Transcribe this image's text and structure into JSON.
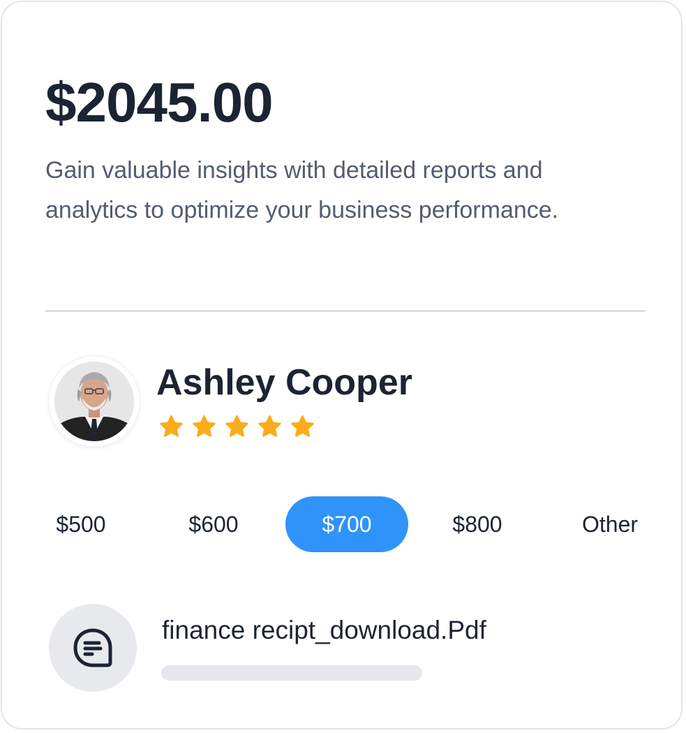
{
  "card": {
    "price": "$2045.00",
    "description": "Gain valuable insights with detailed reports and analytics to optimize your business performance."
  },
  "profile": {
    "name": "Ashley Cooper",
    "avatar_icon": "user-photo",
    "rating": 5,
    "rating_max": 5,
    "star_color": "#fbac1c"
  },
  "amount_options": {
    "items": [
      {
        "label": "$500",
        "selected": false
      },
      {
        "label": "$600",
        "selected": false
      },
      {
        "label": "$700",
        "selected": true
      },
      {
        "label": "$800",
        "selected": false
      },
      {
        "label": "Other",
        "selected": false
      }
    ],
    "selected_color": "#2f93fa"
  },
  "file": {
    "icon": "chat-document-icon",
    "name": "finance recipt_download.Pdf",
    "progress": 0
  }
}
